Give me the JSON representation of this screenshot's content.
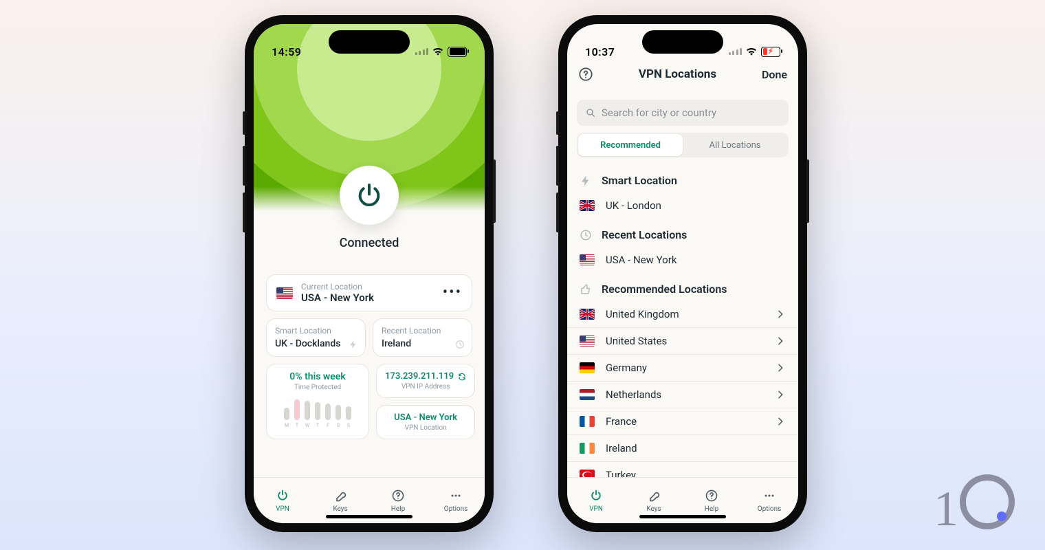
{
  "screen1": {
    "status": {
      "time": "14:59"
    },
    "connected_label": "Connected",
    "current_location": {
      "label": "Current Location",
      "value": "USA - New York",
      "flag": "us"
    },
    "smart_location": {
      "label": "Smart Location",
      "value": "UK - Docklands"
    },
    "recent_location": {
      "label": "Recent Location",
      "value": "Ireland"
    },
    "time_protected": {
      "percent": "0% this week",
      "sub": "Time Protected",
      "days": [
        "M",
        "T",
        "W",
        "T",
        "F",
        "S",
        "S"
      ],
      "heights": [
        18,
        30,
        28,
        26,
        24,
        22,
        20
      ],
      "today_index": 1
    },
    "ip_card": {
      "value": "173.239.211.119",
      "label": "VPN IP Address"
    },
    "loc_card": {
      "value": "USA - New York",
      "label": "VPN Location"
    },
    "tabs": {
      "vpn": "VPN",
      "keys": "Keys",
      "help": "Help",
      "options": "Options"
    }
  },
  "screen2": {
    "status": {
      "time": "10:37"
    },
    "nav": {
      "title": "VPN Locations",
      "done": "Done"
    },
    "search_placeholder": "Search for city or country",
    "segments": {
      "recommended": "Recommended",
      "all": "All Locations"
    },
    "smart": {
      "header": "Smart Location",
      "item": "UK - London",
      "flag": "uk"
    },
    "recent": {
      "header": "Recent Locations",
      "item": "USA - New York",
      "flag": "us"
    },
    "recommended_header": "Recommended Locations",
    "recommended": [
      {
        "name": "United Kingdom",
        "flag": "uk",
        "chevron": true
      },
      {
        "name": "United States",
        "flag": "us",
        "chevron": true
      },
      {
        "name": "Germany",
        "flag": "de",
        "chevron": true
      },
      {
        "name": "Netherlands",
        "flag": "nl",
        "chevron": true
      },
      {
        "name": "France",
        "flag": "fr",
        "chevron": true
      },
      {
        "name": "Ireland",
        "flag": "ie",
        "chevron": false
      },
      {
        "name": "Turkey",
        "flag": "tr",
        "chevron": false
      }
    ],
    "tabs": {
      "vpn": "VPN",
      "keys": "Keys",
      "help": "Help",
      "options": "Options"
    }
  },
  "brand": "10"
}
